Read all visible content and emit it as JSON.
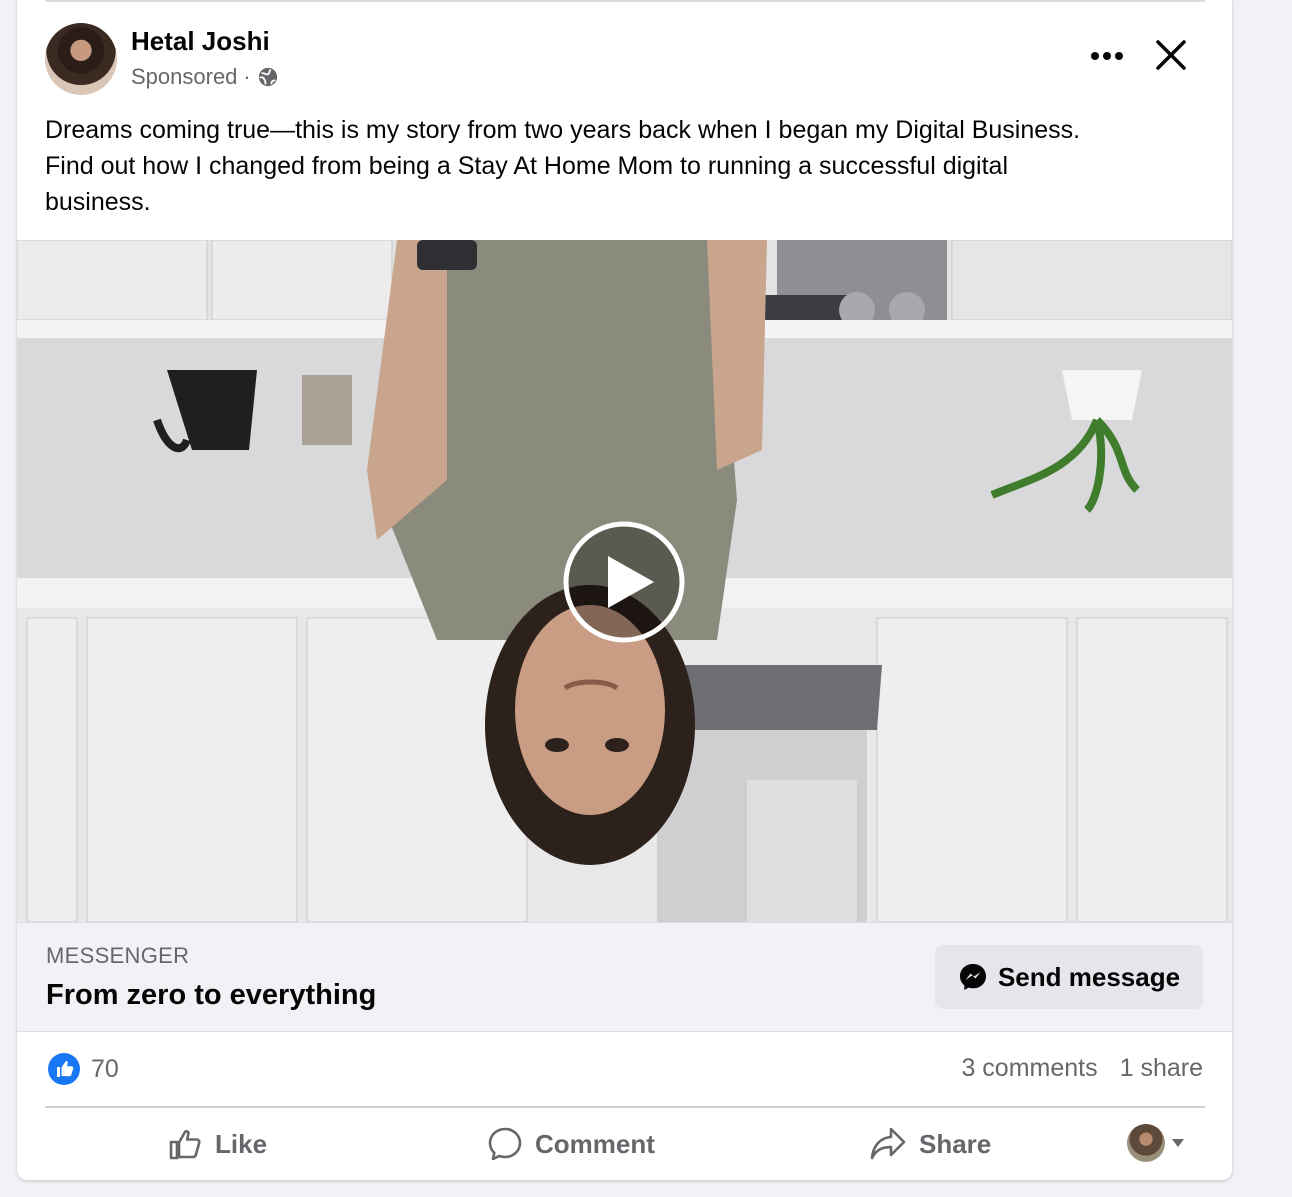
{
  "post": {
    "author": "Hetal Joshi",
    "sponsored": "Sponsored",
    "separator": "·",
    "audience_icon": "globe-icon",
    "caption_line1": "Dreams coming true—this is my story from two years back when I began my Digital Business.",
    "caption_line2": "Find out how I changed from being a Stay At Home Mom to running a successful digital",
    "caption_line3": "business."
  },
  "cta": {
    "source": "MESSENGER",
    "headline": "From zero to everything",
    "button_label": "Send message"
  },
  "engagement": {
    "like_count": "70",
    "comments": "3 comments",
    "shares": "1 share"
  },
  "actions": {
    "like": "Like",
    "comment": "Comment",
    "share": "Share"
  },
  "colors": {
    "like_blue": "#1877f2",
    "secondary_text": "#65676b",
    "cta_background": "#f0f2f5"
  }
}
